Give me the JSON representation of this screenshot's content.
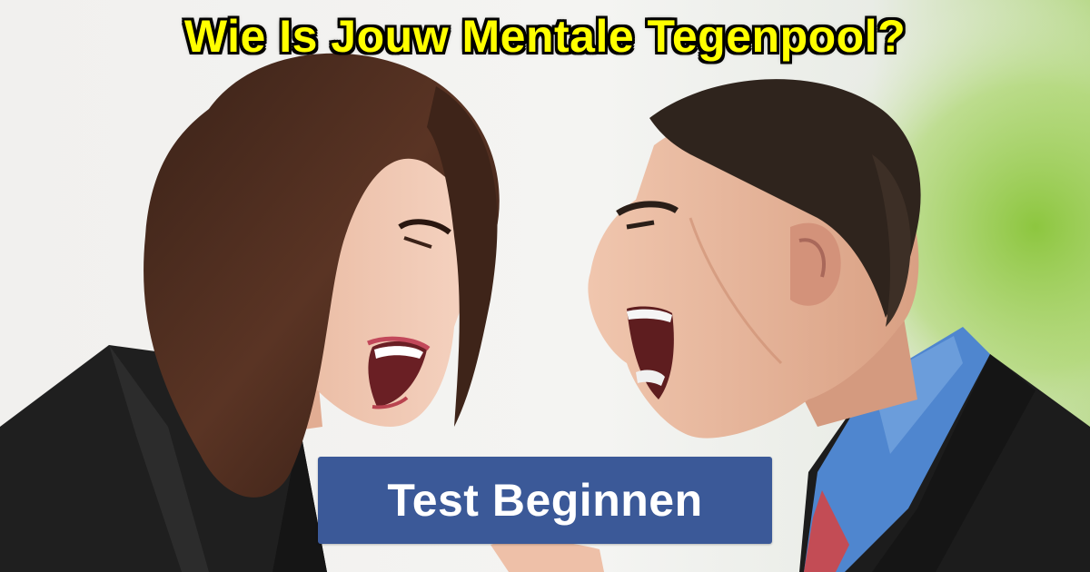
{
  "header": {
    "title": "Wie Is Jouw Mentale Tegenpool?"
  },
  "cta": {
    "label": "Test Beginnen"
  },
  "colors": {
    "title_fill": "#ffff00",
    "title_outline": "#000000",
    "button_bg": "#3b5998",
    "button_text": "#ffffff"
  }
}
